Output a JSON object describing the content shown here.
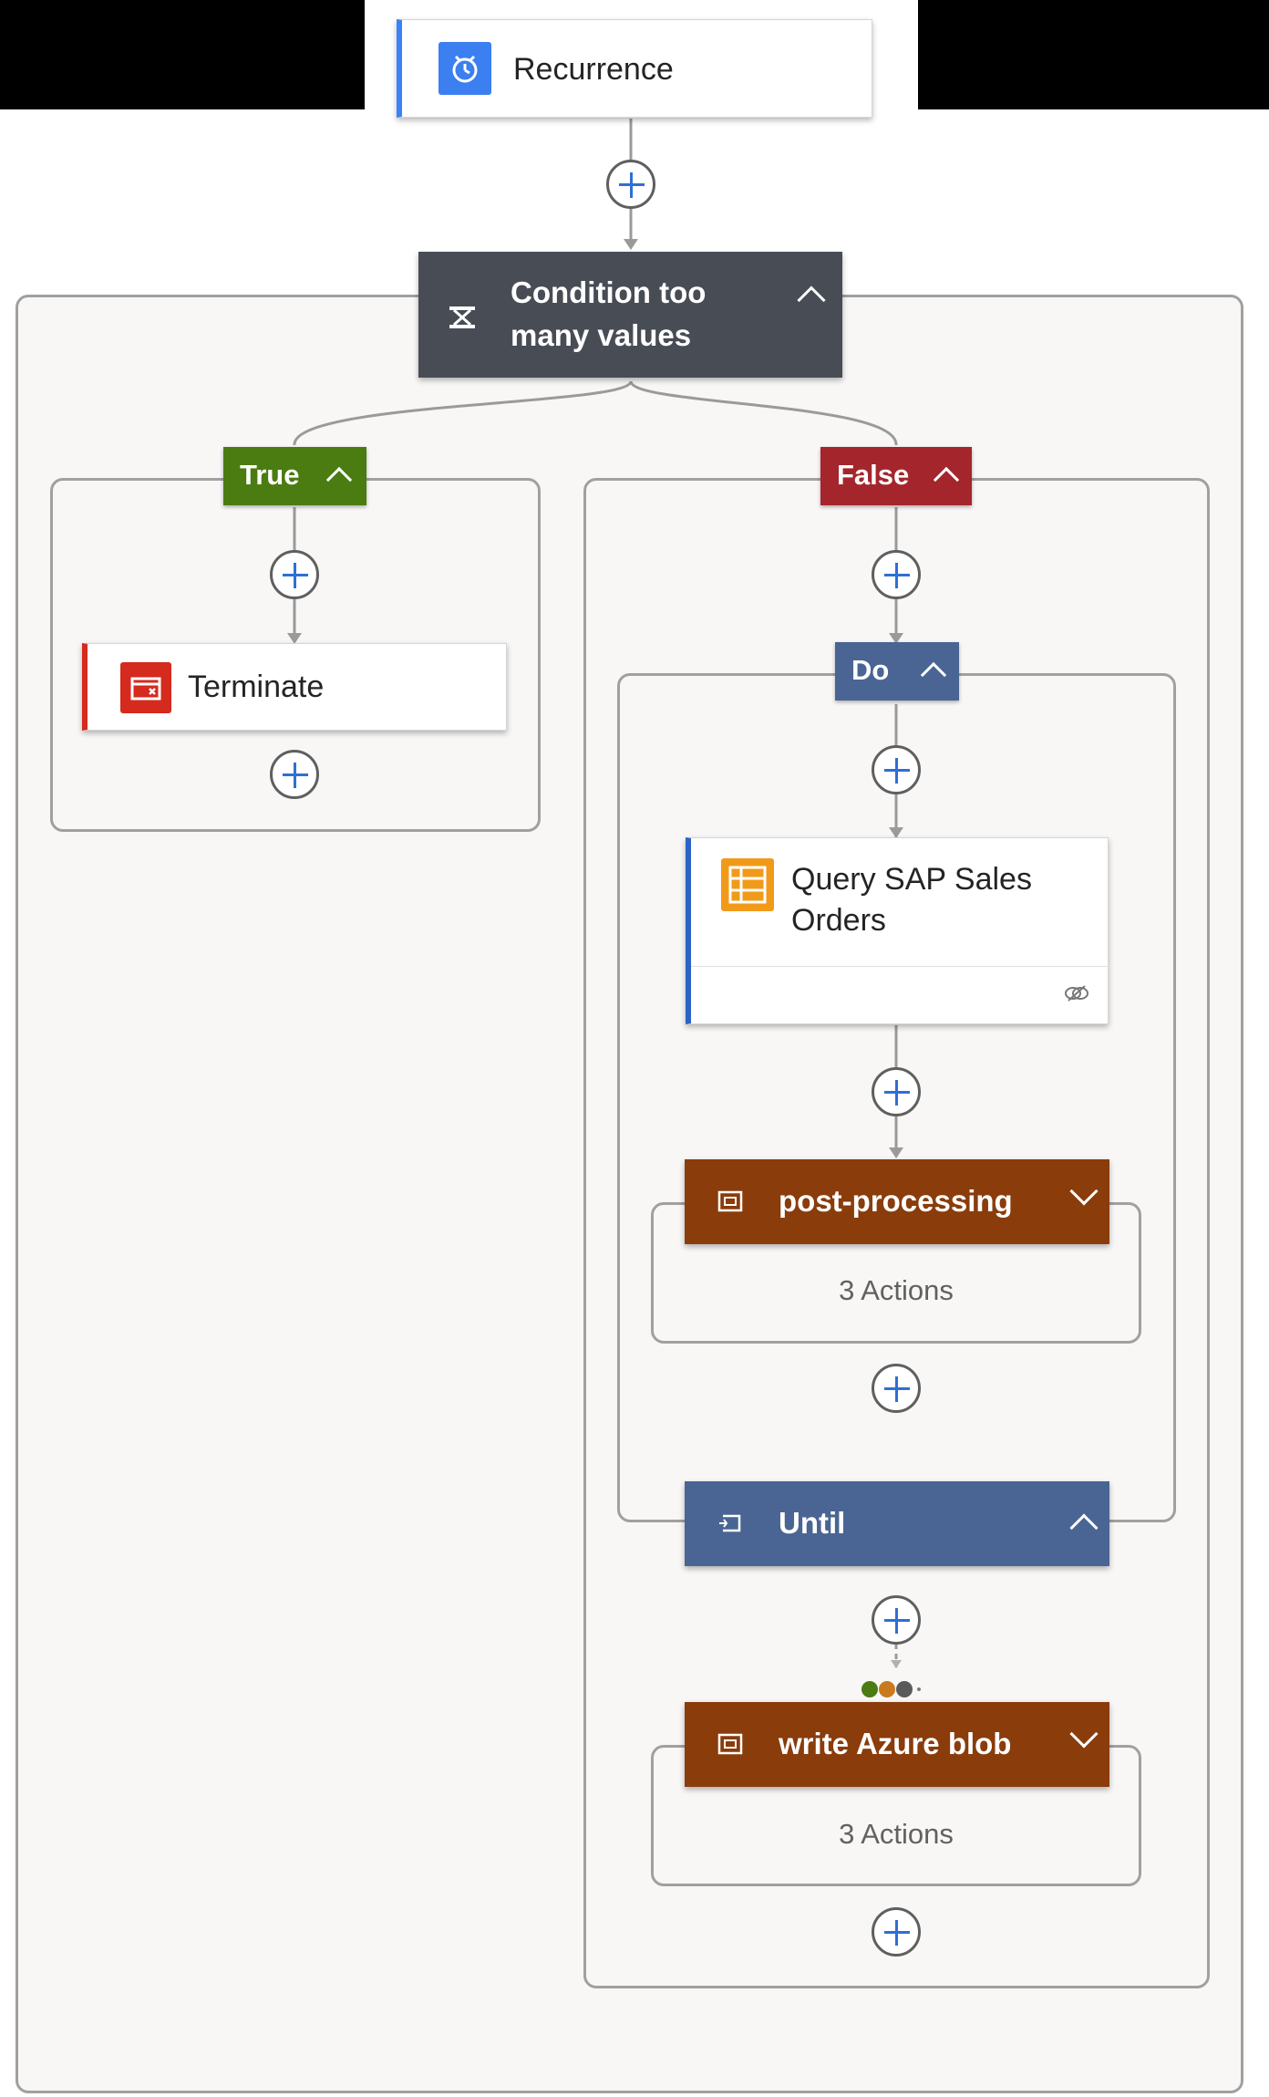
{
  "trigger": {
    "label": "Recurrence",
    "icon": "alarm-clock-icon"
  },
  "condition": {
    "title_line1": "Condition too",
    "title_line2": "many values",
    "icon": "condition-icon"
  },
  "true_branch": {
    "label": "True",
    "terminate_label": "Terminate"
  },
  "false_branch": {
    "label": "False"
  },
  "do_loop": {
    "label": "Do"
  },
  "query_action": {
    "title_line1": "Query SAP Sales",
    "title_line2": "Orders",
    "icon": "table-icon",
    "footer_icon": "link-icon"
  },
  "post_processing": {
    "title": "post-processing",
    "actions_text": "3 Actions"
  },
  "until": {
    "title": "Until"
  },
  "write_blob": {
    "title": "write Azure blob",
    "actions_text": "3 Actions"
  },
  "colors": {
    "dark_header": "#474c55",
    "true_green": "#4a7c12",
    "false_red": "#a4262c",
    "loop_blue": "#4a6593",
    "scope_brown": "#8a3c0b",
    "terminate_red": "#d52a1e",
    "accent_blue": "#3b82f6"
  }
}
